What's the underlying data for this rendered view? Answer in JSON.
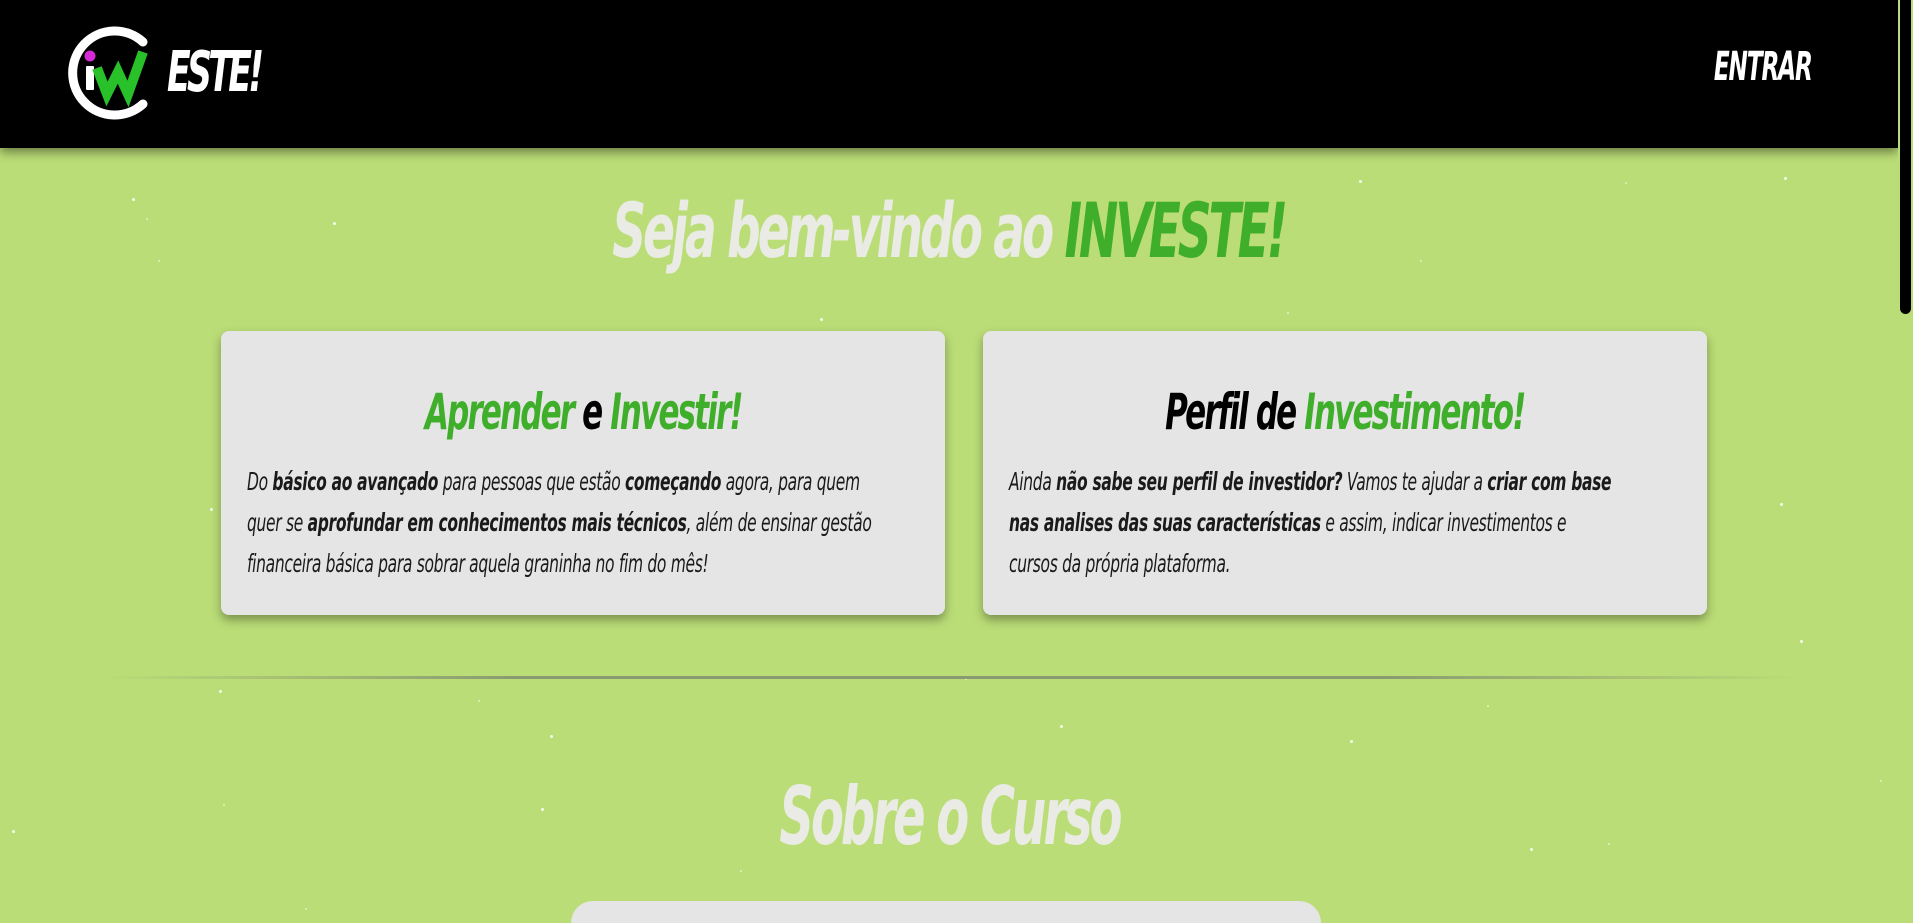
{
  "header": {
    "logo_text": "ESTE!",
    "enter_label": "ENTRAR"
  },
  "hero": {
    "title_part1": "Seja bem-vindo ao ",
    "title_part2": "INVESTE!"
  },
  "cards": [
    {
      "title": [
        "Aprender",
        " e ",
        "Investir!"
      ],
      "lines": [
        [
          "Do ",
          "básico ao avançado",
          " para pessoas que estão ",
          "começando",
          " agora, para quem"
        ],
        [
          "quer se ",
          "aprofundar em conhecimentos mais técnicos",
          ", além de ensinar gestão"
        ],
        [
          "financeira básica para sobrar aquela graninha no fim do mês!"
        ]
      ]
    },
    {
      "title": [
        "Perfil de ",
        "Investimento!"
      ],
      "lines": [
        [
          "Ainda ",
          "não sabe seu perfil de investidor?",
          " Vamos te ajudar a ",
          "criar com base"
        ],
        [
          "nas analises das suas características",
          " e assim, indicar investimentos e"
        ],
        [
          "cursos da própria plataforma."
        ]
      ]
    }
  ],
  "about": {
    "title": "Sobre o Curso"
  },
  "colors": {
    "background": "#bbdd77",
    "header": "#000000",
    "accent_green": "#3fae2a",
    "accent_magenta": "#d62ad6",
    "card": "#e5e5e5"
  },
  "icons": {
    "logo": "investe-logo-icon"
  }
}
